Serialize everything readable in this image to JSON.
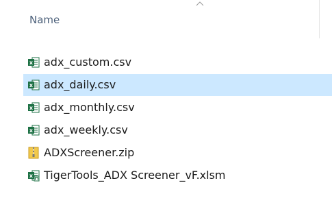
{
  "header": {
    "name_column": "Name"
  },
  "files": [
    {
      "name": "adx_custom.csv",
      "icon": "excel-csv-icon",
      "selected": false
    },
    {
      "name": "adx_daily.csv",
      "icon": "excel-csv-icon",
      "selected": true
    },
    {
      "name": "adx_monthly.csv",
      "icon": "excel-csv-icon",
      "selected": false
    },
    {
      "name": "adx_weekly.csv",
      "icon": "excel-csv-icon",
      "selected": false
    },
    {
      "name": "ADXScreener.zip",
      "icon": "zip-folder-icon",
      "selected": false
    },
    {
      "name": "TigerTools_ADX Screener_vF.xlsm",
      "icon": "excel-macro-icon",
      "selected": false
    }
  ],
  "colors": {
    "selection": "#cce8ff",
    "header_text": "#4c607a",
    "excel_green": "#1e7145"
  }
}
